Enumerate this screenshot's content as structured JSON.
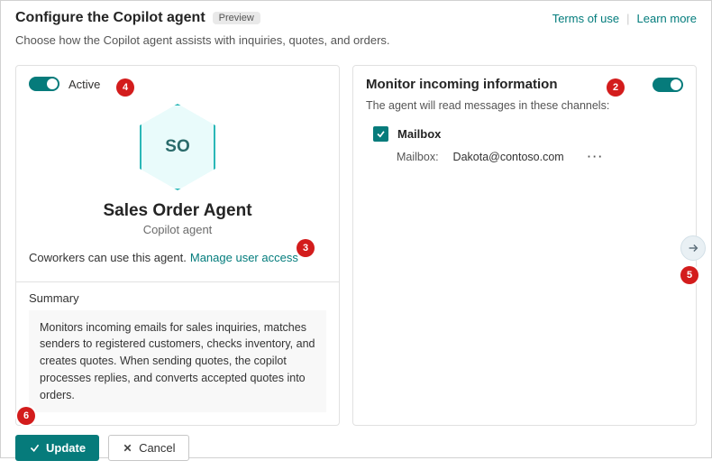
{
  "header": {
    "title": "Configure the Copilot agent",
    "preview_badge": "Preview",
    "terms_link": "Terms of use",
    "learn_link": "Learn more",
    "subtitle": "Choose how the Copilot agent assists with inquiries, quotes, and orders."
  },
  "left": {
    "active_label": "Active",
    "active_on": true,
    "hex_initials": "SO",
    "agent_name": "Sales Order Agent",
    "agent_subtitle": "Copilot agent",
    "access_text": "Coworkers can use this agent.",
    "access_link": "Manage user access",
    "summary_label": "Summary",
    "summary_text": "Monitors incoming emails for sales inquiries, matches senders to registered customers, checks inventory, and creates quotes. When sending quotes, the copilot processes replies, and converts accepted quotes into orders."
  },
  "right": {
    "title": "Monitor incoming information",
    "toggle_on": true,
    "subtitle": "The agent will read messages in these channels:",
    "channel": {
      "checked": true,
      "label": "Mailbox",
      "field_label": "Mailbox:",
      "field_value": "Dakota@contoso.com"
    }
  },
  "footer": {
    "update": "Update",
    "cancel": "Cancel"
  },
  "callouts": {
    "c1_hidden": "",
    "c2": "2",
    "c3": "3",
    "c4": "4",
    "c5": "5",
    "c6": "6"
  }
}
